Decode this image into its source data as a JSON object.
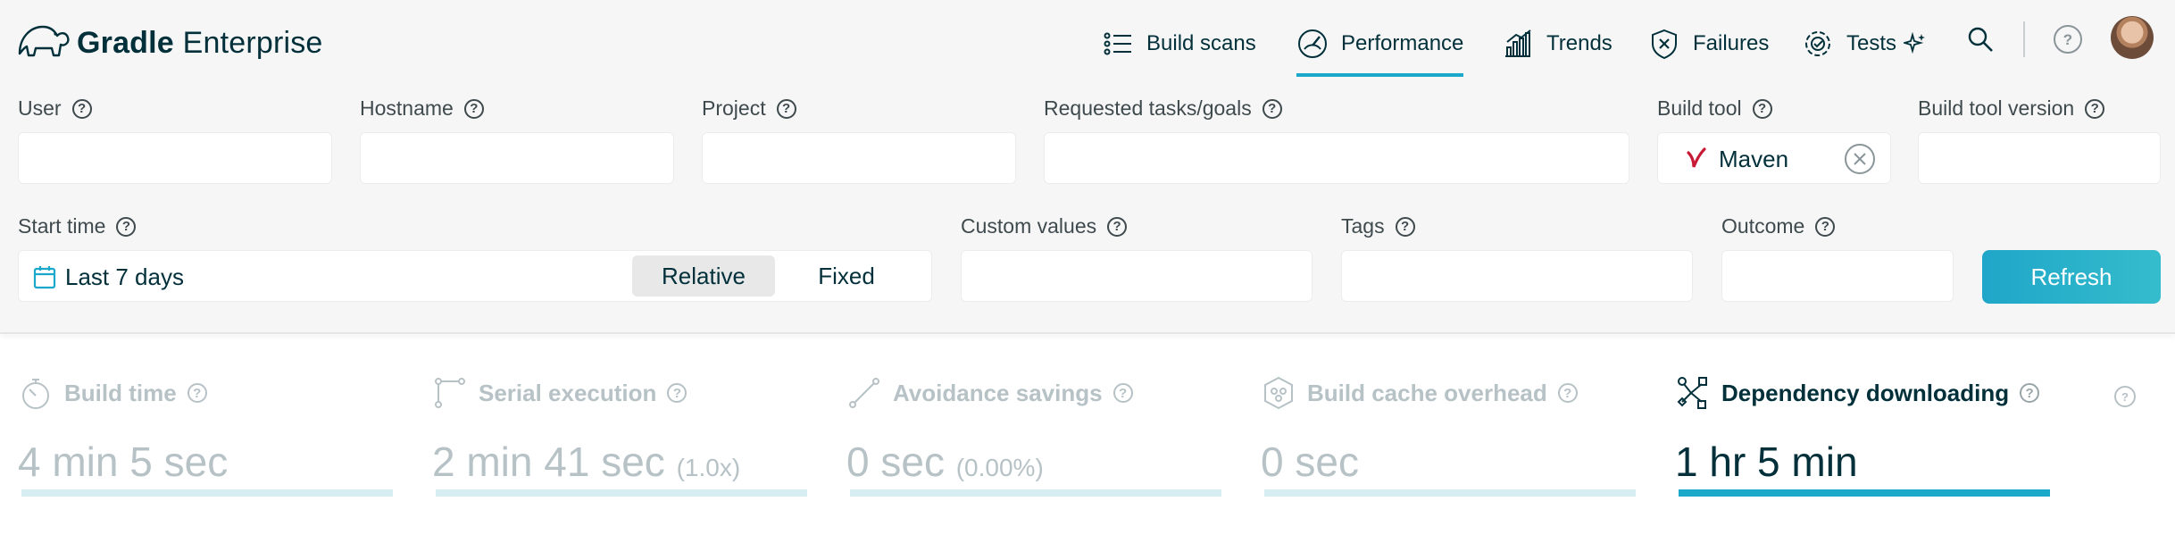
{
  "brand": {
    "name_bold": "Gradle",
    "name_light": "Enterprise"
  },
  "nav": {
    "items": [
      {
        "label": "Build scans",
        "icon": "list-icon"
      },
      {
        "label": "Performance",
        "icon": "speedometer-icon",
        "active": true
      },
      {
        "label": "Trends",
        "icon": "bar-chart-icon"
      },
      {
        "label": "Failures",
        "icon": "shield-x-icon"
      },
      {
        "label": "Tests",
        "icon": "tests-gear-icon"
      }
    ]
  },
  "filters": {
    "user_label": "User",
    "hostname_label": "Hostname",
    "project_label": "Project",
    "tasks_label": "Requested tasks/goals",
    "build_tool_label": "Build tool",
    "build_tool_value": "Maven",
    "build_tool_version_label": "Build tool version",
    "start_time_label": "Start time",
    "start_time_value": "Last 7 days",
    "mode_relative": "Relative",
    "mode_fixed": "Fixed",
    "custom_values_label": "Custom values",
    "tags_label": "Tags",
    "outcome_label": "Outcome",
    "refresh_label": "Refresh",
    "help_glyph": "?"
  },
  "metrics": [
    {
      "label": "Build time",
      "value": "4 min 5 sec",
      "suffix": "",
      "icon": "stopwatch-icon"
    },
    {
      "label": "Serial execution",
      "value": "2 min 41 sec",
      "suffix": "(1.0x)",
      "icon": "serial-path-icon"
    },
    {
      "label": "Avoidance savings",
      "value": "0 sec",
      "suffix": "(0.00%)",
      "icon": "avoidance-path-icon"
    },
    {
      "label": "Build cache overhead",
      "value": "0 sec",
      "suffix": "",
      "icon": "cache-hexagon-icon"
    },
    {
      "label": "Dependency downloading",
      "value": "1 hr 5 min",
      "suffix": "",
      "icon": "dependency-tree-icon",
      "active": true
    }
  ],
  "colors": {
    "accent": "#1ba8cb",
    "text": "#02303a",
    "muted": "#b7c2c6",
    "background": "#f6f6f6"
  }
}
